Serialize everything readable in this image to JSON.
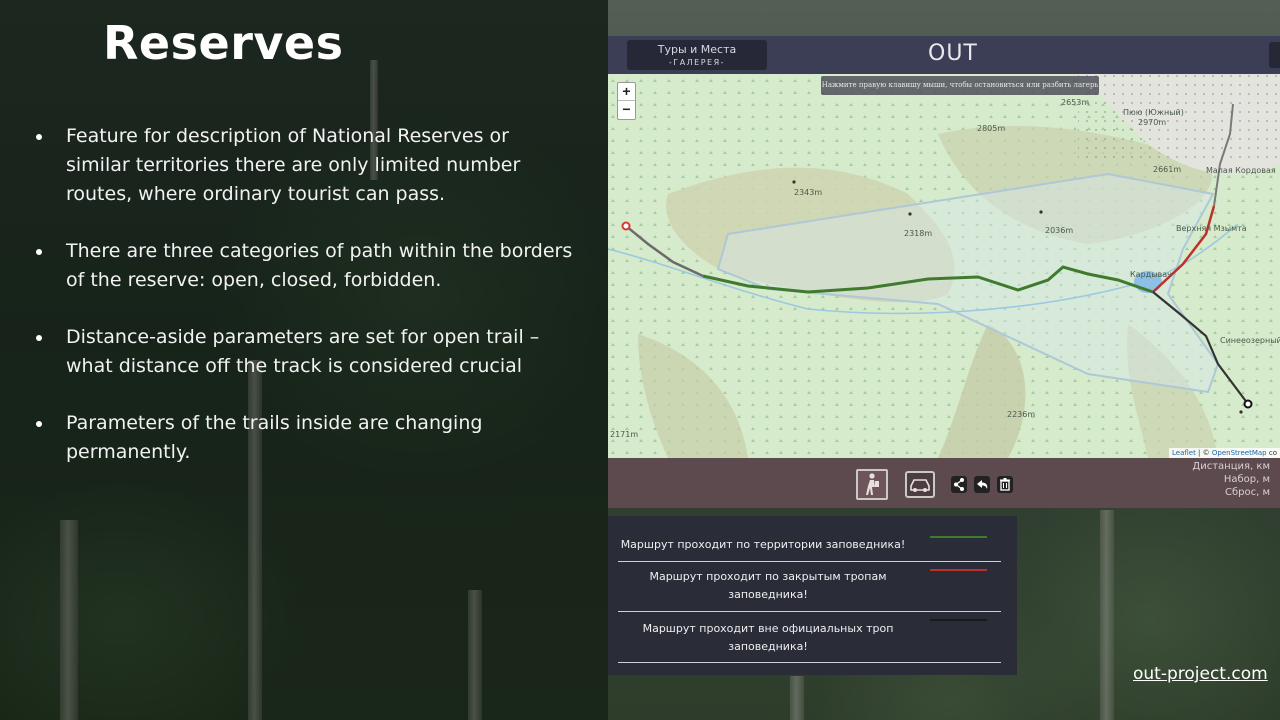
{
  "slide": {
    "title": "Reserves",
    "bullets": [
      "Feature for description of National Reserves or similar territories there are only limited number routes, where ordinary tourist can pass.",
      "There are three categories of path within the borders of the reserve: open, closed, forbidden.",
      "Distance-aside parameters are set for open trail – what distance off the track is considered crucial",
      "Parameters of the trails inside are changing permanently."
    ],
    "footer_link": "out-project.com"
  },
  "app": {
    "header": {
      "tours_label": "Туры и Места",
      "gallery_label": "-ГАЛЕРЕЯ-",
      "logo": "OUT"
    },
    "map": {
      "hint": "Нажмите правую клавишу мыши, чтобы остановиться или разбить лагерь",
      "zoom_in": "+",
      "zoom_out": "−",
      "elevations": [
        "2653m",
        "2805m",
        "2970m",
        "2661m",
        "2343m",
        "2318m",
        "2036m",
        "2236m",
        "2171m"
      ],
      "place_labels": [
        "Пюю (Южный)",
        "Кардывач",
        "Малая Кордовая",
        "Верхняя Мзымта",
        "Синееозерный"
      ],
      "attribution_leaflet": "Leaflet",
      "attribution_osm": "OpenStreetMap",
      "attribution_suffix": "co"
    },
    "toolbar": {
      "hiker_icon": "hiker-icon",
      "car_icon": "car-icon",
      "share_icon": "share-icon",
      "undo_icon": "undo-icon",
      "trash_icon": "trash-icon",
      "stats": [
        "Дистанция, км",
        "Набор, м",
        "Сброс, м"
      ]
    },
    "legend": [
      {
        "text": "Маршрут проходит по территории заповедника!",
        "color": "#3f7a2e"
      },
      {
        "text": "Маршрут проходит по закрытым тропам заповедника!",
        "color": "#c0302a"
      },
      {
        "text": "Маршрут проходит вне официальных троп заповедника!",
        "color": "#1a1a1a"
      }
    ]
  }
}
